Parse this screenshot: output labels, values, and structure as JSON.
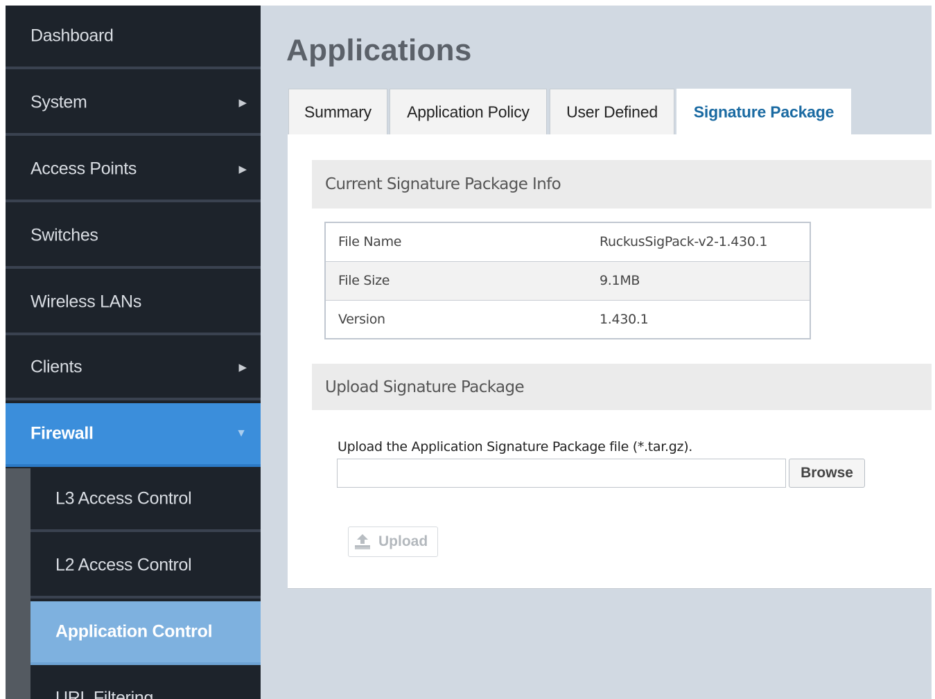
{
  "sidebar": {
    "items": [
      {
        "label": "Dashboard",
        "has_arrow": false
      },
      {
        "label": "System",
        "arrow": "▶"
      },
      {
        "label": "Access Points",
        "arrow": "▶"
      },
      {
        "label": "Switches"
      },
      {
        "label": "Wireless LANs"
      },
      {
        "label": "Clients",
        "arrow": "▶"
      },
      {
        "label": "Firewall",
        "arrow": "▼",
        "active": true
      }
    ],
    "sub_items": [
      {
        "label": "L3 Access Control"
      },
      {
        "label": "L2 Access Control"
      },
      {
        "label": "Application Control",
        "active": true
      },
      {
        "label": "URL Filtering"
      }
    ]
  },
  "page": {
    "title": "Applications"
  },
  "tabs": [
    {
      "label": "Summary"
    },
    {
      "label": "Application Policy"
    },
    {
      "label": "User Defined"
    },
    {
      "label": "Signature Package",
      "active": true
    }
  ],
  "current_info": {
    "heading": "Current Signature Package Info",
    "rows": [
      {
        "key": "File Name",
        "value": "RuckusSigPack-v2-1.430.1"
      },
      {
        "key": "File Size",
        "value": "9.1MB"
      },
      {
        "key": "Version",
        "value": "1.430.1"
      }
    ]
  },
  "upload": {
    "heading": "Upload Signature Package",
    "instruction": "Upload the Application Signature Package file (*.tar.gz).",
    "file_value": "",
    "browse_label": "Browse",
    "upload_label": "Upload",
    "upload_icon": "upload-icon"
  },
  "colors": {
    "sidebar_bg": "#1d232b",
    "active_nav": "#3b8edb",
    "active_subnav": "#7eb1df",
    "active_tab_text": "#1a6aa2",
    "content_bg": "#d1d9e2"
  }
}
